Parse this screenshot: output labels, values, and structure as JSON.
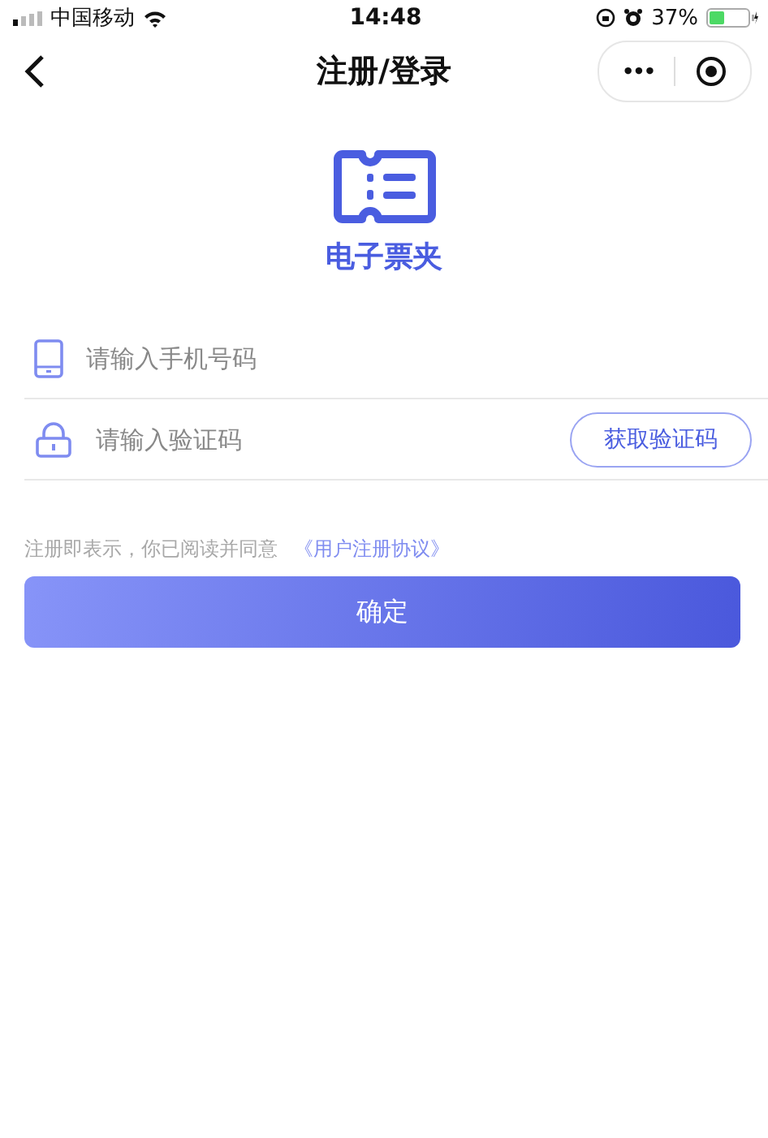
{
  "status_bar": {
    "carrier": "中国移动",
    "time": "14:48",
    "battery": "37%"
  },
  "nav": {
    "title": "注册/登录",
    "more": "•••"
  },
  "brand": {
    "name": "电子票夹"
  },
  "form": {
    "fields": [
      {
        "kind": "phone",
        "placeholder": "请输入手机号码"
      },
      {
        "kind": "code",
        "placeholder": "请输入验证码",
        "button": "获取验证码"
      }
    ]
  },
  "agreement": {
    "text": "注册即表示，你已阅读并同意",
    "link": "《用户注册协议》"
  },
  "submit": "确定"
}
